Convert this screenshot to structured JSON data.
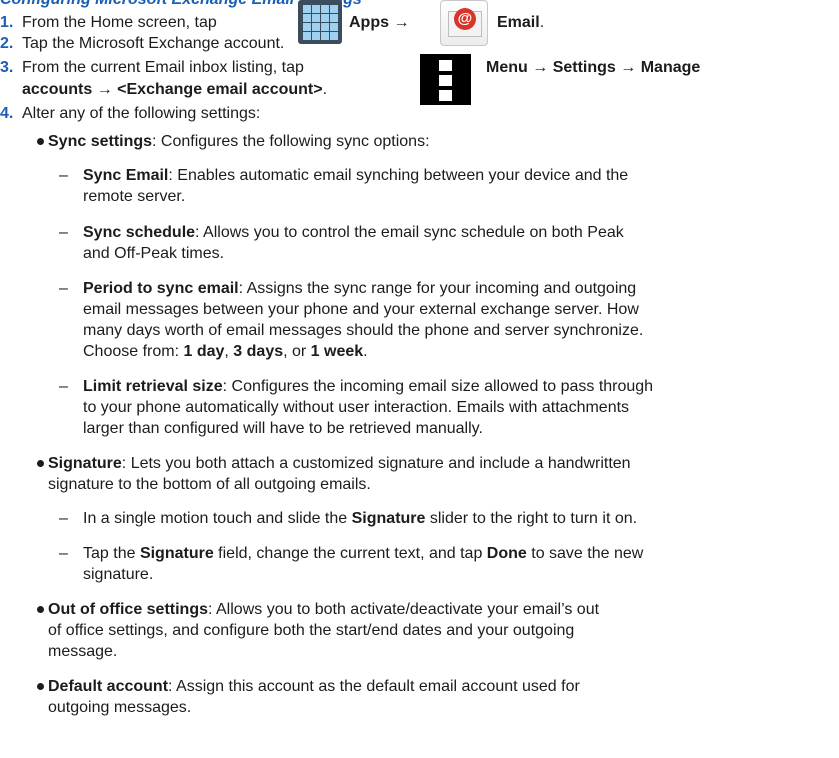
{
  "heading": "Configuring Microsoft Exchange Email Settings",
  "steps": {
    "s1": {
      "num": "1.",
      "text_a": "From the Home screen, tap",
      "apps_label": "Apps",
      "arrow": "→",
      "email_label": "Email",
      "period": "."
    },
    "s2": {
      "num": "2.",
      "text": "Tap the Microsoft Exchange account."
    },
    "s3": {
      "num": "3.",
      "text_a": "From the current Email inbox listing, tap",
      "menu_label": "Menu",
      "arrow1": "→",
      "settings_label": "Settings",
      "arrow2": "→",
      "manage_label": "Manage",
      "accounts_label": "accounts",
      "arrow3": "→",
      "exchange_label": "<Exchange email account>",
      "period": "."
    },
    "s4": {
      "num": "4.",
      "text": "Alter any of the following settings:"
    }
  },
  "settings": {
    "sync": {
      "title": "Sync settings",
      "desc": ": Configures the following sync options:",
      "options": {
        "sync_email": {
          "title": "Sync Email",
          "desc_l1": ": Enables automatic email synching between your device and the",
          "desc_l2": "remote server."
        },
        "sync_schedule": {
          "title": "Sync schedule",
          "desc_l1": ": Allows you to control the email sync schedule on both Peak",
          "desc_l2": "and Off-Peak times."
        },
        "period": {
          "title": "Period to sync email",
          "desc_l1": ": Assigns the sync range for your incoming and outgoing",
          "desc_l2": "email messages between your phone and your external exchange server. How",
          "desc_l3": "many days worth of email messages should the phone and server synchronize.",
          "choose": "Choose from: ",
          "opt1": "1 day",
          "sep1": ", ",
          "opt2": "3 days",
          "sep2": ", or ",
          "opt3": "1 week",
          "end": "."
        },
        "limit": {
          "title": "Limit retrieval size",
          "desc_l1": ": Configures the incoming email size allowed to pass through",
          "desc_l2": "to your phone automatically without user interaction. Emails with attachments",
          "desc_l3": "larger than configured will have to be retrieved manually."
        }
      }
    },
    "signature": {
      "title": "Signature",
      "desc_l1": ": Lets you both attach a customized signature and include a handwritten",
      "desc_l2": "signature to the bottom of all outgoing emails.",
      "sub1_a": "In a single motion touch and slide the ",
      "sub1_b": "Signature",
      "sub1_c": " slider to the right to turn it on.",
      "sub2_a": "Tap the ",
      "sub2_b": "Signature",
      "sub2_c": " field, change the current text, and tap ",
      "sub2_d": "Done",
      "sub2_e": " to save the new",
      "sub2_l2": "signature."
    },
    "ooo": {
      "title": "Out of office settings",
      "desc_l1": ": Allows you to both activate/deactivate your email’s out",
      "desc_l2": "of office settings, and configure both the start/end dates and your outgoing",
      "desc_l3": "message."
    },
    "default_account": {
      "title": "Default account",
      "desc_l1": ": Assign this account as the default email account used for",
      "desc_l2": "outgoing messages."
    }
  },
  "icons": {
    "apps": "apps-grid-icon",
    "email": "email-icon",
    "menu": "menu-icon"
  },
  "colors": {
    "step_number": "#1a5fb4",
    "text": "#1c1c1c"
  }
}
